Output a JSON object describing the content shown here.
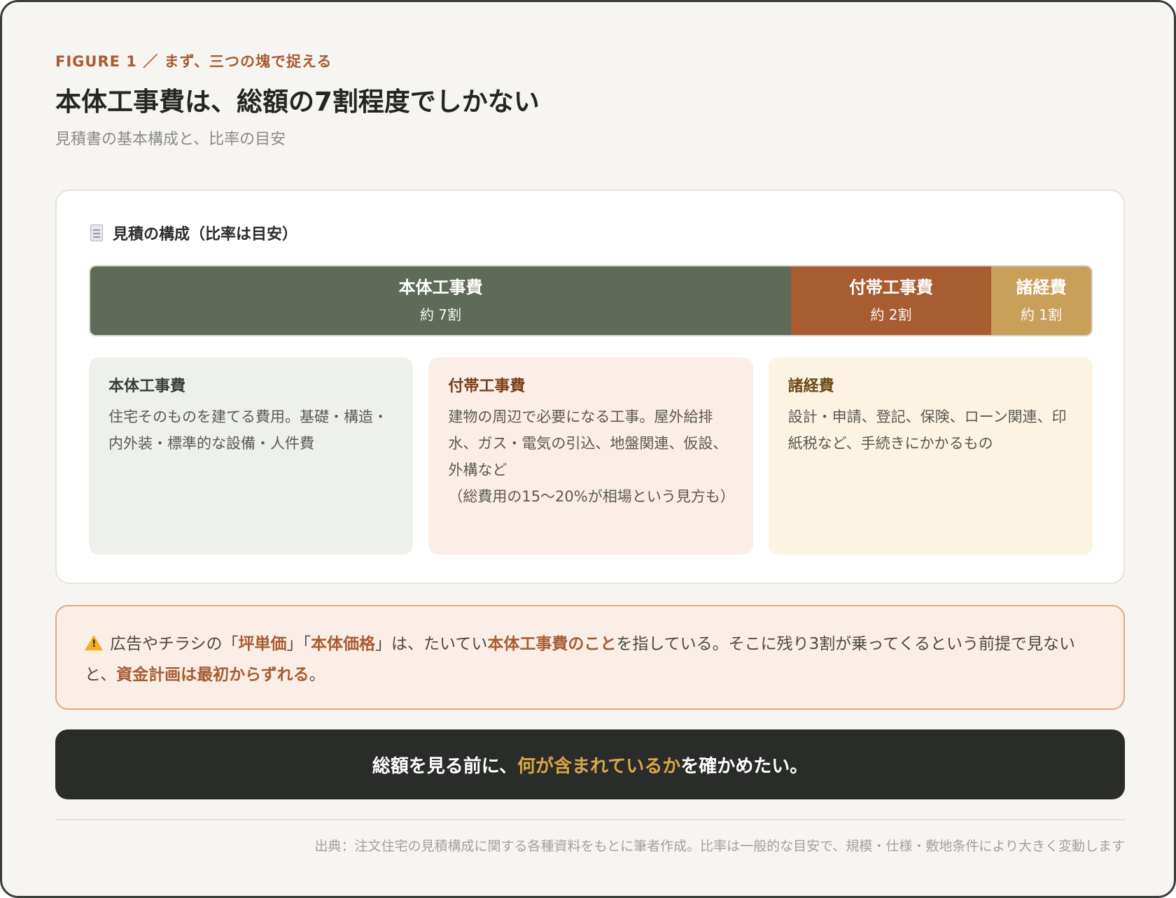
{
  "header": {
    "eyebrow": "FIGURE 1 ／ まず、三つの塊で捉える",
    "title": "本体工事費は、総額の7割程度でしかない",
    "subtitle": "見積書の基本構成と、比率の目安"
  },
  "card": {
    "icon": "document-icon",
    "title": "見積の構成（比率は目安）"
  },
  "composition": {
    "segments": [
      {
        "name": "本体工事費",
        "ratio_label": "約 7割",
        "share": 0.7,
        "color": "#5f6b58"
      },
      {
        "name": "付帯工事費",
        "ratio_label": "約 2割",
        "share": 0.2,
        "color": "#a85c32"
      },
      {
        "name": "諸経費",
        "ratio_label": "約 1割",
        "share": 0.1,
        "color": "#c9a05a"
      }
    ]
  },
  "details": [
    {
      "name": "本体工事費",
      "desc": "住宅そのものを建てる費用。基礎・構造・内外装・標準的な設備・人件費",
      "bg": "#eef0ec",
      "fg": "#3a3c39"
    },
    {
      "name": "付帯工事費",
      "desc": "建物の周辺で必要になる工事。屋外給排水、ガス・電気の引込、地盤関連、仮設、外構など\n（総費用の15〜20%が相場という見方も）",
      "bg": "#fbeee6",
      "fg": "#7a3e1c"
    },
    {
      "name": "諸経費",
      "desc": "設計・申請、登記、保険、ローン関連、印紙税など、手続きにかかるもの",
      "bg": "#fcf3e3",
      "fg": "#6a4a14"
    }
  ],
  "warning": {
    "icon": "warning-icon",
    "t1": "広告やチラシの「",
    "h1": "坪単価",
    "t2": "」「",
    "h2": "本体価格",
    "t3": "」は、たいてい",
    "h3": "本体工事費のこと",
    "t4": "を指している。そこに残り3割が乗ってくるという前提で見ないと、",
    "h4": "資金計画は最初からずれる",
    "t5": "。"
  },
  "banner": {
    "pre": "総額を見る前に、",
    "highlight": "何が含まれているか",
    "post": "を確かめたい。"
  },
  "source": "出典：注文住宅の見積構成に関する各種資料をもとに筆者作成。比率は一般的な目安で、規模・仕様・敷地条件により大きく変動します"
}
